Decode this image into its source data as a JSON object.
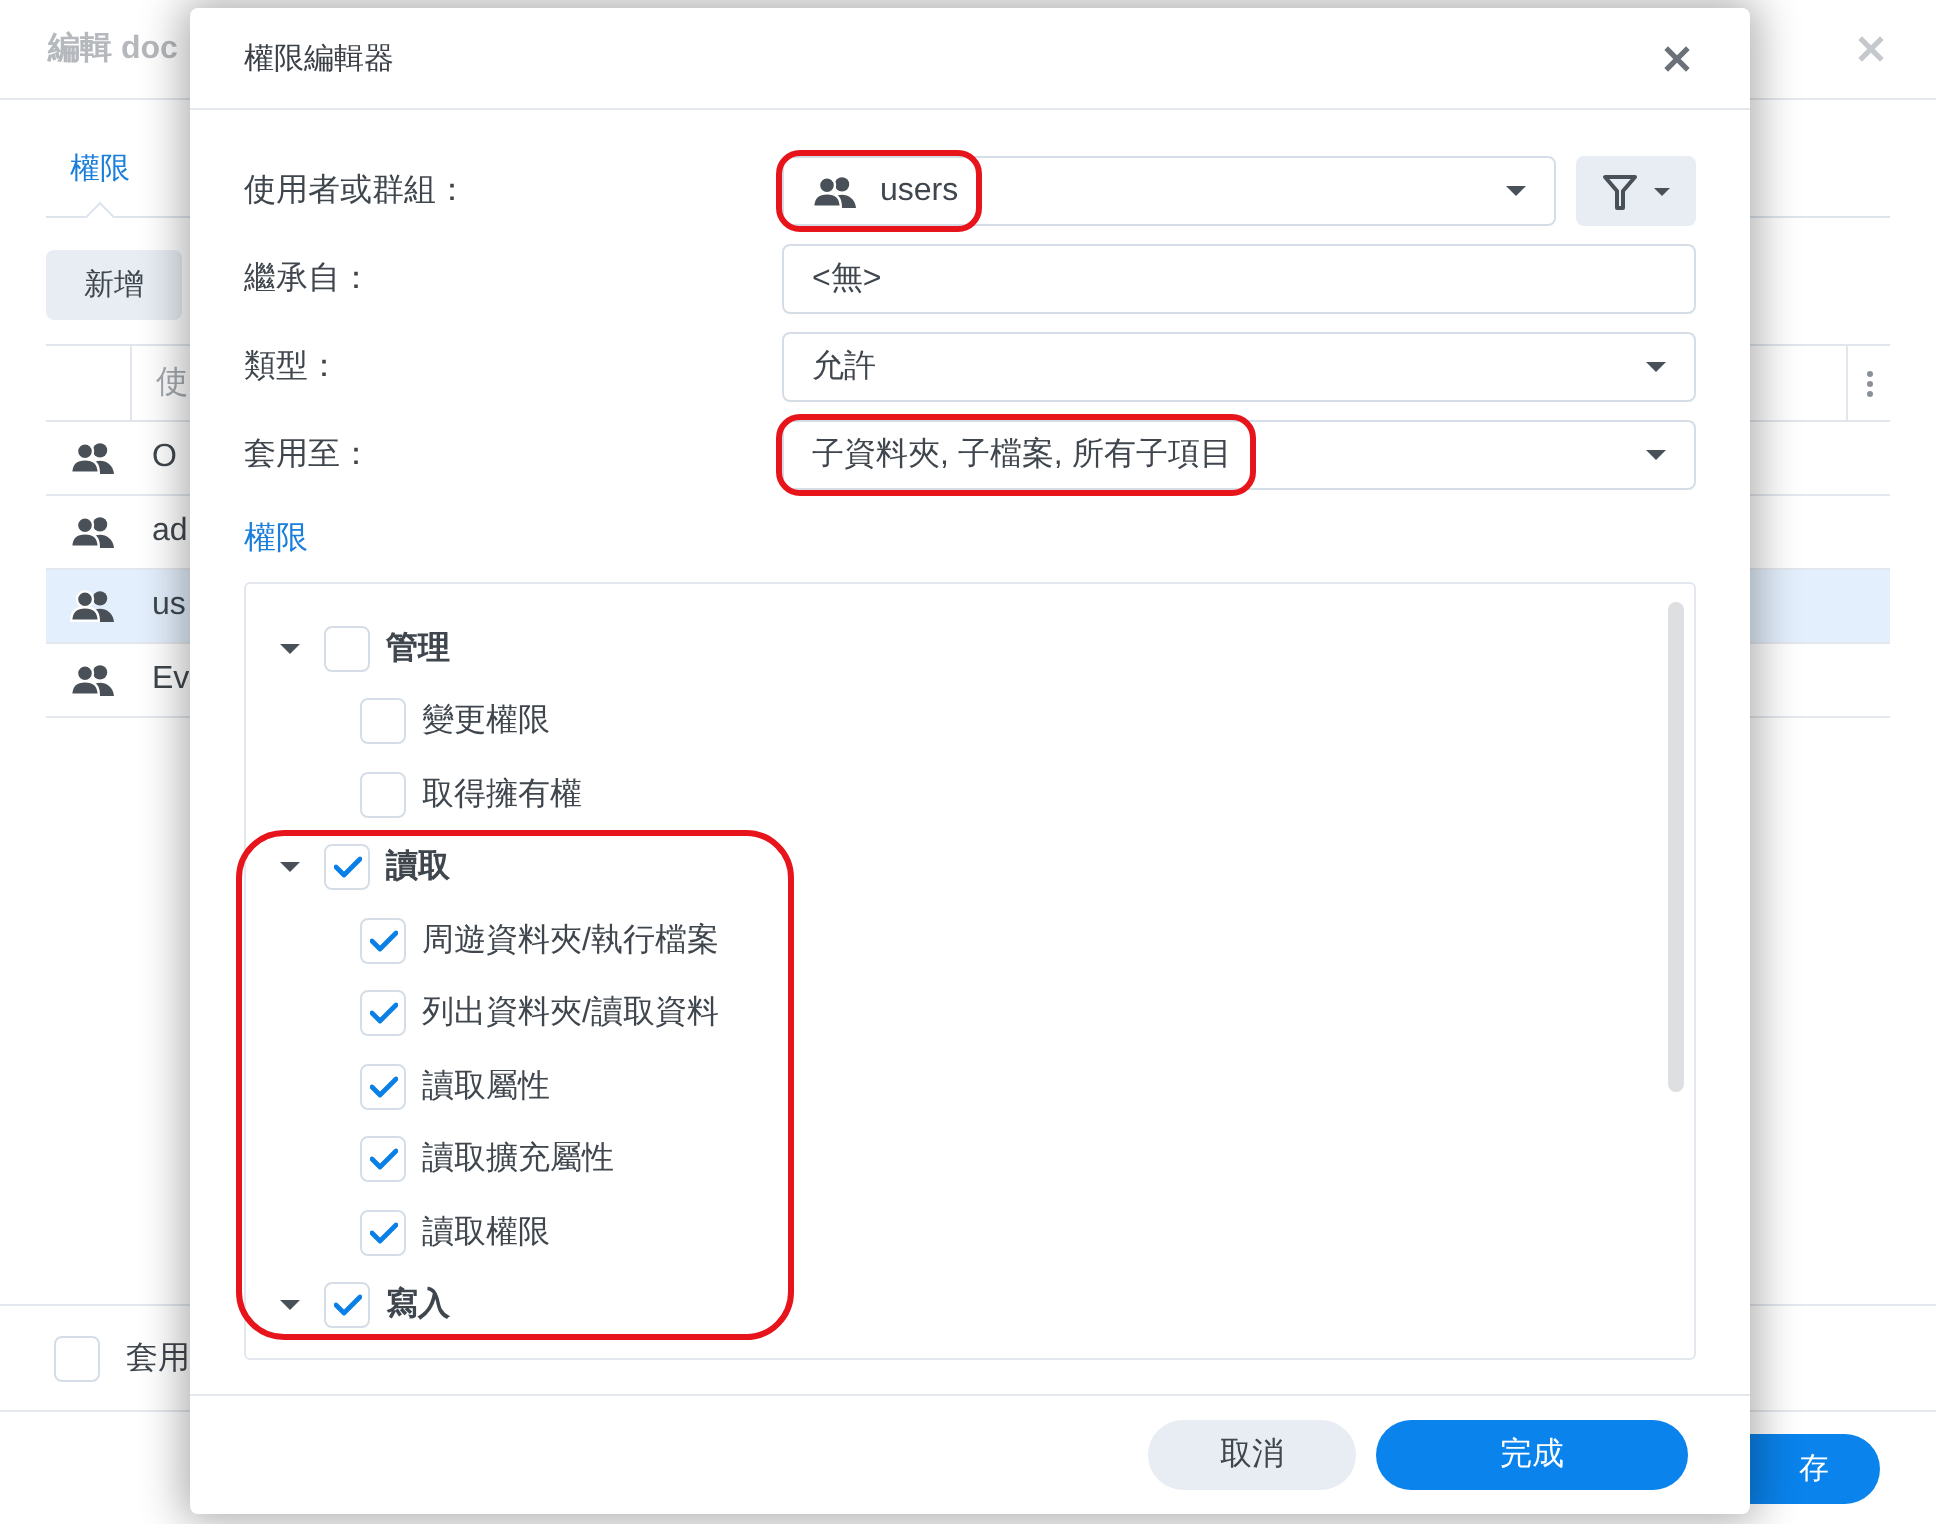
{
  "background_dialog": {
    "title": "編輯 doc",
    "tabs": [
      {
        "label": "權限",
        "selected": true
      }
    ],
    "add_button": "新增",
    "table": {
      "columns": [
        "使"
      ],
      "rows": [
        {
          "name": "O",
          "selected": false
        },
        {
          "name": "ad",
          "selected": false
        },
        {
          "name": "us",
          "selected": true
        },
        {
          "name": "Ev",
          "selected": false
        }
      ]
    },
    "apply_option": {
      "label": "套用",
      "checked": false
    },
    "save_button": "存"
  },
  "dialog": {
    "title": "權限編輯器",
    "fields": [
      {
        "label": "使用者或群組：",
        "kind": "user_select",
        "value": "users",
        "highlighted": true
      },
      {
        "label": "繼承自：",
        "kind": "text",
        "value": "<無>",
        "highlighted": false
      },
      {
        "label": "類型：",
        "kind": "select",
        "value": "允許",
        "highlighted": false
      },
      {
        "label": "套用至：",
        "kind": "select",
        "value": "子資料夾, 子檔案, 所有子項目",
        "highlighted": true
      }
    ],
    "permissions_heading": "權限",
    "permissions": [
      {
        "label": "管理",
        "checked": false,
        "expanded": true,
        "highlighted": false,
        "children": [
          {
            "label": "變更權限",
            "checked": false
          },
          {
            "label": "取得擁有權",
            "checked": false
          }
        ]
      },
      {
        "label": "讀取",
        "checked": true,
        "expanded": true,
        "highlighted": true,
        "children": [
          {
            "label": "周遊資料夾/執行檔案",
            "checked": true
          },
          {
            "label": "列出資料夾/讀取資料",
            "checked": true
          },
          {
            "label": "讀取屬性",
            "checked": true
          },
          {
            "label": "讀取擴充屬性",
            "checked": true
          },
          {
            "label": "讀取權限",
            "checked": true
          }
        ]
      },
      {
        "label": "寫入",
        "checked": true,
        "expanded": true,
        "highlighted": true
      }
    ],
    "buttons": [
      {
        "label": "取消",
        "kind": "secondary"
      },
      {
        "label": "完成",
        "kind": "primary"
      }
    ]
  }
}
